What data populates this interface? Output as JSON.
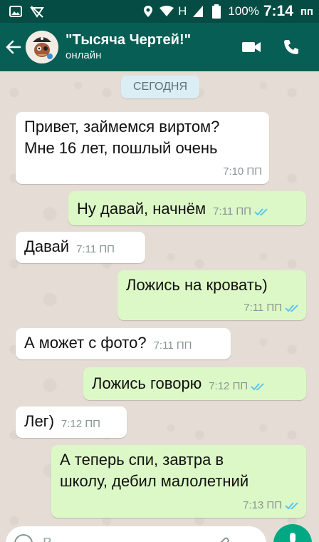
{
  "status_bar": {
    "network_label": "H",
    "battery": "100%",
    "time": "7:14",
    "time_suffix": "пп"
  },
  "header": {
    "title": "\"Тысяча Чертей!\"",
    "subtitle": "онлайн",
    "icons": [
      "back-arrow-icon",
      "avatar",
      "video-call-icon",
      "voice-call-icon"
    ]
  },
  "chat": {
    "date_chip": "СЕГОДНЯ",
    "messages": [
      {
        "direction": "in",
        "text_lines": [
          "Привет, займемся виртом?",
          "Мне 16 лет, пошлый очень"
        ],
        "time": "7:10 ПП"
      },
      {
        "direction": "out",
        "text": "Ну давай, начнём",
        "time": "7:11 ПП",
        "status": "read"
      },
      {
        "direction": "in",
        "text": "Давай",
        "time": "7:11 ПП"
      },
      {
        "direction": "out",
        "text": "Ложись на кровать)",
        "time": "7:11 ПП",
        "status": "read"
      },
      {
        "direction": "in",
        "text": "А может с фото?",
        "time": "7:11 ПП"
      },
      {
        "direction": "out",
        "text": "Ложись говорю",
        "time": "7:12 ПП",
        "status": "read"
      },
      {
        "direction": "in",
        "text": "Лег)",
        "time": "7:12 ПП"
      },
      {
        "direction": "out",
        "text_lines": [
          "А теперь спи, завтра в",
          "школу, дебил малолетний"
        ],
        "time": "7:13 ПП",
        "status": "read"
      }
    ]
  },
  "input": {
    "placeholder": "В"
  },
  "colors": {
    "status_bar": "#054d44",
    "header": "#075e54",
    "chat_bg": "#e5ddd5",
    "bubble_in": "#ffffff",
    "bubble_out": "#dcf8c6",
    "read_ticks": "#4fc3f7",
    "fab": "#00a884"
  }
}
